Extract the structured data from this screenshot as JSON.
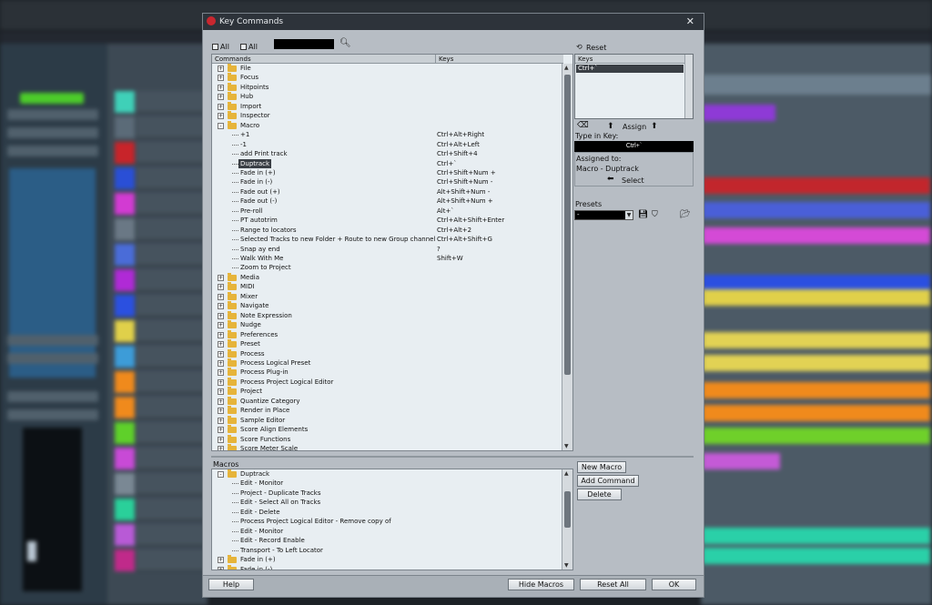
{
  "dialog": {
    "title": "Key Commands",
    "close_glyph": "✕",
    "all_expand_label": "All",
    "all_collapse_label": "All",
    "search_value": "",
    "columns": {
      "commands": "Commands",
      "keys": "Keys"
    },
    "commands": [
      {
        "label": "File",
        "type": "folder",
        "state": "+"
      },
      {
        "label": "Focus",
        "type": "folder",
        "state": "+"
      },
      {
        "label": "Hitpoints",
        "type": "folder",
        "state": "+"
      },
      {
        "label": "Hub",
        "type": "folder",
        "state": "+"
      },
      {
        "label": "Import",
        "type": "folder",
        "state": "+"
      },
      {
        "label": "Inspector",
        "type": "folder",
        "state": "+"
      },
      {
        "label": "Macro",
        "type": "folder",
        "state": "-"
      },
      {
        "label": "+1",
        "type": "cmd",
        "keys": "Ctrl+Alt+Right"
      },
      {
        "label": "-1",
        "type": "cmd",
        "keys": "Ctrl+Alt+Left"
      },
      {
        "label": "add Print track",
        "type": "cmd",
        "keys": "Ctrl+Shift+4"
      },
      {
        "label": "Duptrack",
        "type": "cmd",
        "keys": "Ctrl+`",
        "selected": true
      },
      {
        "label": "Fade in (+)",
        "type": "cmd",
        "keys": "Ctrl+Shift+Num +"
      },
      {
        "label": "Fade in (-)",
        "type": "cmd",
        "keys": "Ctrl+Shift+Num -"
      },
      {
        "label": "Fade out (+)",
        "type": "cmd",
        "keys": "Alt+Shift+Num -"
      },
      {
        "label": "Fade out (-)",
        "type": "cmd",
        "keys": "Alt+Shift+Num +"
      },
      {
        "label": "Pre-roll",
        "type": "cmd",
        "keys": "Alt+`"
      },
      {
        "label": "PT autotrim",
        "type": "cmd",
        "keys": "Ctrl+Alt+Shift+Enter"
      },
      {
        "label": "Range to locators",
        "type": "cmd",
        "keys": "Ctrl+Alt+2"
      },
      {
        "label": "Selected Tracks to new Folder + Route to new Group channel",
        "type": "cmd",
        "keys": "Ctrl+Alt+Shift+G"
      },
      {
        "label": "Snap ay end",
        "type": "cmd",
        "keys": "?"
      },
      {
        "label": "Walk With Me",
        "type": "cmd",
        "keys": "Shift+W"
      },
      {
        "label": "Zoom to Project",
        "type": "cmd",
        "keys": ""
      },
      {
        "label": "Media",
        "type": "folder",
        "state": "+"
      },
      {
        "label": "MIDI",
        "type": "folder",
        "state": "+"
      },
      {
        "label": "Mixer",
        "type": "folder",
        "state": "+"
      },
      {
        "label": "Navigate",
        "type": "folder",
        "state": "+"
      },
      {
        "label": "Note Expression",
        "type": "folder",
        "state": "+"
      },
      {
        "label": "Nudge",
        "type": "folder",
        "state": "+"
      },
      {
        "label": "Preferences",
        "type": "folder",
        "state": "+"
      },
      {
        "label": "Preset",
        "type": "folder",
        "state": "+"
      },
      {
        "label": "Process",
        "type": "folder",
        "state": "+"
      },
      {
        "label": "Process Logical Preset",
        "type": "folder",
        "state": "+"
      },
      {
        "label": "Process Plug-in",
        "type": "folder",
        "state": "+"
      },
      {
        "label": "Process Project Logical Editor",
        "type": "folder",
        "state": "+"
      },
      {
        "label": "Project",
        "type": "folder",
        "state": "+"
      },
      {
        "label": "Quantize Category",
        "type": "folder",
        "state": "+"
      },
      {
        "label": "Render in Place",
        "type": "folder",
        "state": "+"
      },
      {
        "label": "Sample Editor",
        "type": "folder",
        "state": "+"
      },
      {
        "label": "Score Align Elements",
        "type": "folder",
        "state": "+"
      },
      {
        "label": "Score Functions",
        "type": "folder",
        "state": "+"
      },
      {
        "label": "Score Meter Scale",
        "type": "folder",
        "state": "+"
      }
    ],
    "right": {
      "reset_label": "Reset",
      "keys_header": "Keys",
      "current_key": "Ctrl+`",
      "assign_label": "Assign",
      "type_in_key_label": "Type in Key:",
      "type_in_key_value": "Ctrl+`",
      "assigned_to_label": "Assigned to:",
      "assigned_to_value": "Macro - Duptrack",
      "select_label": "Select",
      "presets_label": "Presets",
      "preset_value": "-"
    },
    "macros": {
      "label": "Macros",
      "items": [
        {
          "label": "Duptrack",
          "type": "folder",
          "state": "-",
          "selected": true
        },
        {
          "label": "Edit - Monitor",
          "type": "cmd"
        },
        {
          "label": "Project - Duplicate Tracks",
          "type": "cmd"
        },
        {
          "label": "Edit - Select All on Tracks",
          "type": "cmd"
        },
        {
          "label": "Edit - Delete",
          "type": "cmd"
        },
        {
          "label": "Process Project Logical Editor - Remove copy of",
          "type": "cmd"
        },
        {
          "label": "Edit - Monitor",
          "type": "cmd"
        },
        {
          "label": "Edit - Record Enable",
          "type": "cmd"
        },
        {
          "label": "Transport - To Left Locator",
          "type": "cmd"
        },
        {
          "label": "Fade in (+)",
          "type": "folder",
          "state": "+"
        },
        {
          "label": "Fade in (-)",
          "type": "folder",
          "state": "+"
        }
      ],
      "new_macro_label": "New Macro",
      "add_command_label": "Add Command",
      "delete_label": "Delete"
    },
    "footer": {
      "help_label": "Help",
      "hide_macros_label": "Hide Macros",
      "reset_all_label": "Reset All",
      "ok_label": "OK"
    }
  },
  "colors": {
    "dialog_bg": "#b7bdc4",
    "list_bg": "#e8eef2",
    "selection": "#3a3f45",
    "folder": "#e6b43a"
  }
}
